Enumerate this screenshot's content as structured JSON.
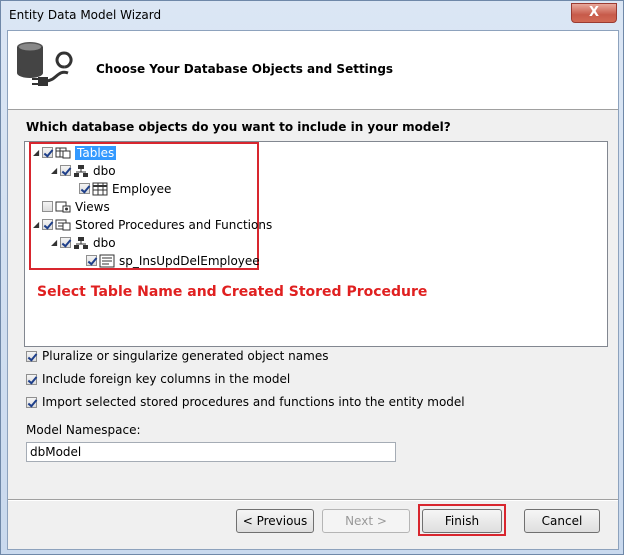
{
  "window": {
    "title": "Entity Data Model Wizard",
    "close_label": "X"
  },
  "header": {
    "title": "Choose Your Database Objects and Settings"
  },
  "question": "Which database objects do you want to include in your model?",
  "tree": {
    "tables_label": "Tables",
    "tables_schema": "dbo",
    "tables_item": "Employee",
    "views_label": "Views",
    "procs_label": "Stored Procedures and Functions",
    "procs_schema": "dbo",
    "procs_item": "sp_InsUpdDelEmployee"
  },
  "annotation": "Select Table Name and Created Stored Procedure",
  "options": {
    "pluralize": "Pluralize or singularize generated object names",
    "foreign_keys": "Include foreign key columns in the model",
    "import_procs": "Import selected stored procedures and functions into the entity model"
  },
  "namespace": {
    "label": "Model Namespace:",
    "value": "dbModel"
  },
  "buttons": {
    "previous": "< Previous",
    "next": "Next >",
    "finish": "Finish",
    "cancel": "Cancel"
  },
  "colors": {
    "annotation_red": "#d8262e",
    "selection_blue": "#3399ff"
  },
  "icons": [
    "database-plug-icon",
    "table-folder-icon",
    "schema-icon",
    "table-icon",
    "view-folder-icon",
    "proc-folder-icon",
    "stored-procedure-icon"
  ]
}
